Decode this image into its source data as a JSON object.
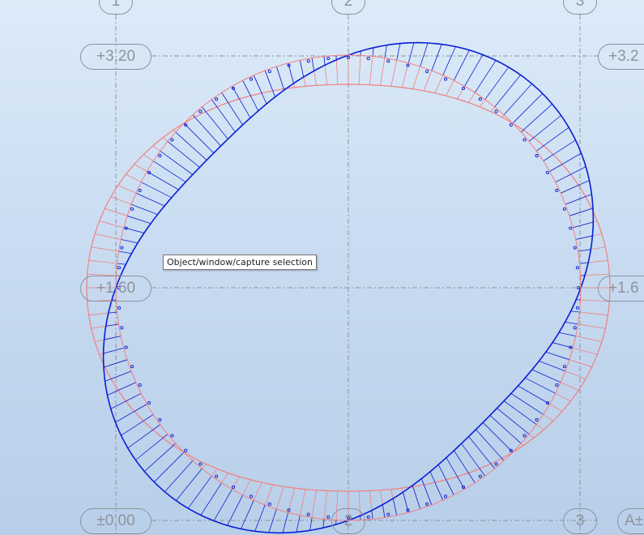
{
  "grid": {
    "axes": [
      "1",
      "2",
      "3"
    ],
    "levels": {
      "top": "+3.20",
      "top_right": "+3.2",
      "middle": "+1.60",
      "middle_right": "+1.6",
      "bottom": "±0.00",
      "bottom_right": "A±"
    }
  },
  "tooltip": {
    "text": "Object/window/capture selection"
  },
  "colors": {
    "background_top": "#dcebf8",
    "background_bottom": "#b9cfe9",
    "gridline": "#8d939a",
    "load_diagram_red": "#f08080",
    "load_diagram_blue": "#0a1fd6"
  }
}
